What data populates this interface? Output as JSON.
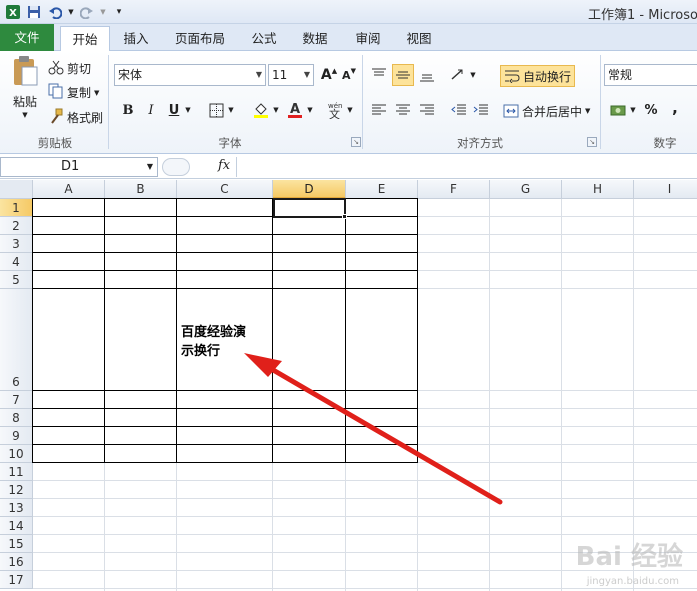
{
  "window": {
    "title": "工作簿1 - Microso"
  },
  "tabs": [
    {
      "label": "文件"
    },
    {
      "label": "开始"
    },
    {
      "label": "插入"
    },
    {
      "label": "页面布局"
    },
    {
      "label": "公式"
    },
    {
      "label": "数据"
    },
    {
      "label": "审阅"
    },
    {
      "label": "视图"
    }
  ],
  "clipboard": {
    "paste": "粘贴",
    "cut": "剪切",
    "copy": "复制",
    "format_painter": "格式刷",
    "group": "剪贴板"
  },
  "font": {
    "name": "宋体",
    "size": "11",
    "group": "字体",
    "bold": "B",
    "italic": "I",
    "underline": "U",
    "grow": "A",
    "shrink": "A"
  },
  "alignment": {
    "wrap_text": "自动换行",
    "merge_center": "合并后居中",
    "group": "对齐方式"
  },
  "number": {
    "format": "常规",
    "percent": "%",
    "comma": ",",
    "group": "数字"
  },
  "formula_bar": {
    "name_box": "D1",
    "fx": "fx",
    "content": ""
  },
  "columns": [
    "A",
    "B",
    "C",
    "D",
    "E",
    "F",
    "G",
    "H",
    "I"
  ],
  "rows": [
    "1",
    "2",
    "3",
    "4",
    "5",
    "6",
    "7",
    "8",
    "9",
    "10",
    "11",
    "12",
    "13",
    "14",
    "15",
    "16",
    "17"
  ],
  "cells": {
    "C6_line1": "百度经验演",
    "C6_line2": "示换行"
  },
  "watermark": {
    "text": "Bai 经验",
    "sub": "jingyan.baidu.com"
  },
  "colors": {
    "file_tab": "#2e8a3e",
    "selected_header": "#f5c965",
    "arrow": "#e0201a"
  }
}
